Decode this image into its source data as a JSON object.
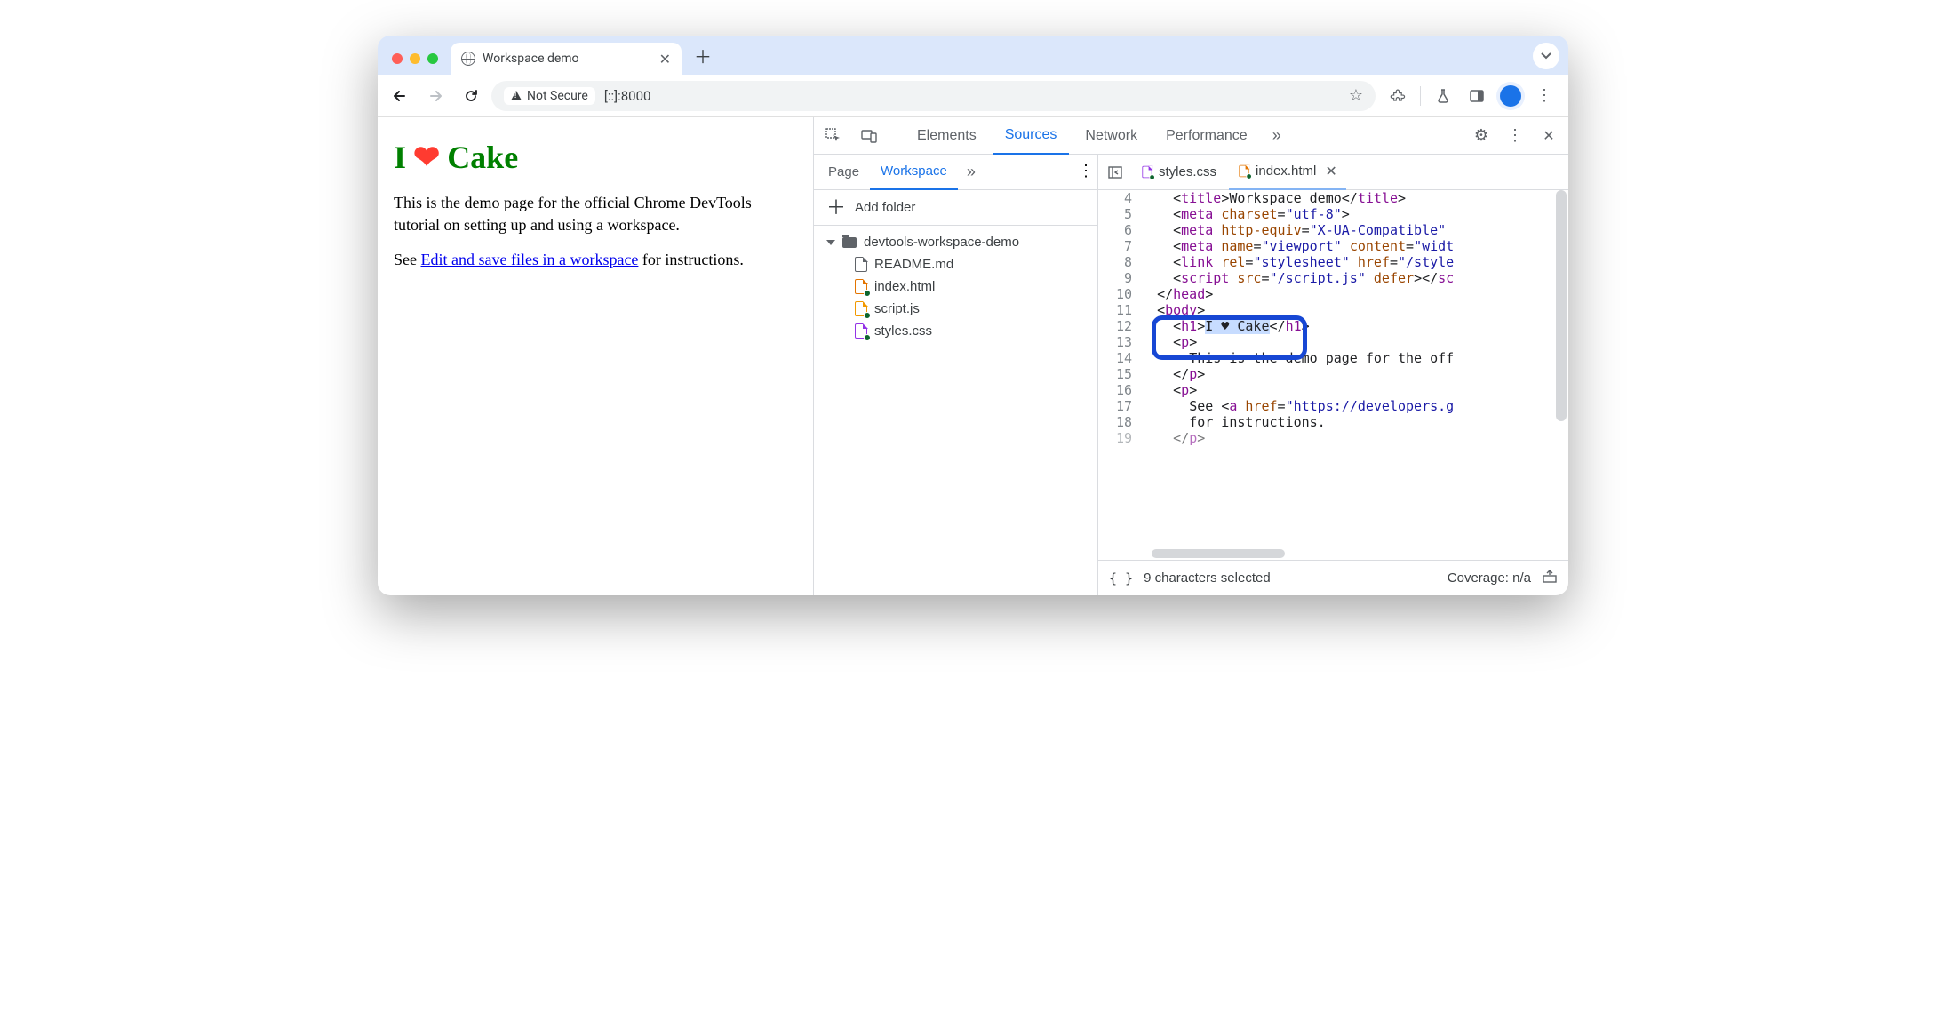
{
  "browser": {
    "tab_title": "Workspace demo",
    "security_label": "Not Secure",
    "url": "[::]:8000"
  },
  "page": {
    "title_prefix": "I",
    "title_heart": "❤",
    "title_suffix": "Cake",
    "para1": "This is the demo page for the official Chrome DevTools tutorial on setting up and using a workspace.",
    "para2_prefix": "See ",
    "link_text": "Edit and save files in a workspace",
    "para2_suffix": " for instructions."
  },
  "devtools": {
    "tabs": {
      "elements": "Elements",
      "sources": "Sources",
      "network": "Network",
      "performance": "Performance"
    },
    "navigator": {
      "page_tab": "Page",
      "workspace_tab": "Workspace",
      "add_folder": "Add folder",
      "root": "devtools-workspace-demo",
      "files": {
        "readme": "README.md",
        "index": "index.html",
        "script": "script.js",
        "styles": "styles.css"
      }
    },
    "editor_tabs": {
      "styles": "styles.css",
      "index": "index.html"
    },
    "status": {
      "selected": "9 characters selected",
      "coverage": "Coverage: n/a"
    },
    "code": {
      "l4": "    <title>Workspace demo</title>",
      "l5": "    <meta charset=\"utf-8\">",
      "l6": "    <meta http-equiv=\"X-UA-Compatible\" ",
      "l7": "    <meta name=\"viewport\" content=\"widt",
      "l8": "    <link rel=\"stylesheet\" href=\"/style",
      "l9": "    <script src=\"/script.js\" defer></sc",
      "l10": "  </head>",
      "l11": "  <body>",
      "l12": "    <h1>I ♥ Cake</h1>",
      "l13": "    <p>",
      "l14": "      This is the demo page for the off",
      "l15": "    </p>",
      "l16": "    <p>",
      "l17": "      See <a href=\"https://developers.g",
      "l18": "      for instructions.",
      "l19": "    </p>"
    }
  }
}
